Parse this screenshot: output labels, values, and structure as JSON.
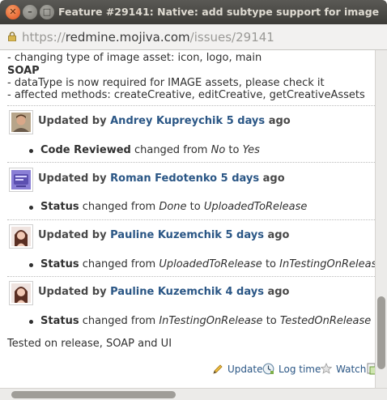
{
  "window": {
    "title": "Feature #29141: Native: add subtype support for image",
    "close_glyph": "✕",
    "minimize_glyph": "–",
    "maximize_glyph": "□"
  },
  "url": {
    "protocol": "https://",
    "domain": "redmine.mojiva.com",
    "path": "/issues/29141"
  },
  "description": {
    "line1": "- changing type of image asset: icon, logo, main",
    "soap_heading": "SOAP",
    "line2": "- dataType is now required for IMAGE assets, please check it",
    "line3": "- affected methods: createCreative, editCreative, getCreativeAssets"
  },
  "journals": [
    {
      "prefix": "Updated by",
      "author": "Andrey Kupreychik",
      "age": "5 days",
      "suffix": "ago",
      "field": "Code Reviewed",
      "changed_from": "changed from",
      "old": "No",
      "to": "to",
      "new": "Yes"
    },
    {
      "prefix": "Updated by",
      "author": "Roman Fedotenko",
      "age": "5 days",
      "suffix": "ago",
      "field": "Status",
      "changed_from": "changed from",
      "old": "Done",
      "to": "to",
      "new": "UploadedToRelease"
    },
    {
      "prefix": "Updated by",
      "author": "Pauline Kuzemchik",
      "age": "5 days",
      "suffix": "ago",
      "field": "Status",
      "changed_from": "changed from",
      "old": "UploadedToRelease",
      "to": "to",
      "new": "InTestingOnRelease"
    },
    {
      "prefix": "Updated by",
      "author": "Pauline Kuzemchik",
      "age": "4 days",
      "suffix": "ago",
      "field": "Status",
      "changed_from": "changed from",
      "old": "InTestingOnRelease",
      "to": "to",
      "new": "TestedOnRelease",
      "note": "Tested on release, SOAP and UI"
    }
  ],
  "actions": {
    "update": "Update",
    "log_time": "Log time",
    "watch": "Watch"
  },
  "colors": {
    "link": "#2a5685",
    "text": "#303030",
    "titlebar": "#3d3c38"
  }
}
